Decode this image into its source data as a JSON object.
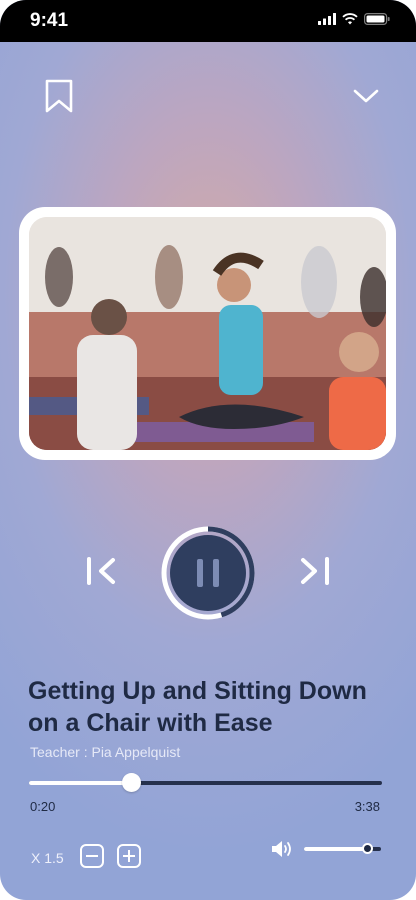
{
  "status_bar": {
    "time": "9:41"
  },
  "player": {
    "state": "playing",
    "icons": {
      "bookmark": "bookmark-icon",
      "collapse": "chevron-down-icon",
      "previous": "skip-previous-icon",
      "next": "skip-next-icon",
      "pause": "pause-icon",
      "volume": "volume-icon"
    },
    "ring_progress": 0.45
  },
  "track": {
    "title": "Getting Up and Sitting Down on a Chair with Ease",
    "teacher": "Teacher : Pia Appelquist",
    "current_time": "0:20",
    "total_time": "3:38",
    "progress": 0.29
  },
  "playback": {
    "speed_label": "X 1.5",
    "volume": 0.82
  },
  "colors": {
    "accent_dark": "#1f2a44",
    "pause_button": "#2f3e5f",
    "track_bg": "#25304c",
    "white": "#ffffff"
  }
}
